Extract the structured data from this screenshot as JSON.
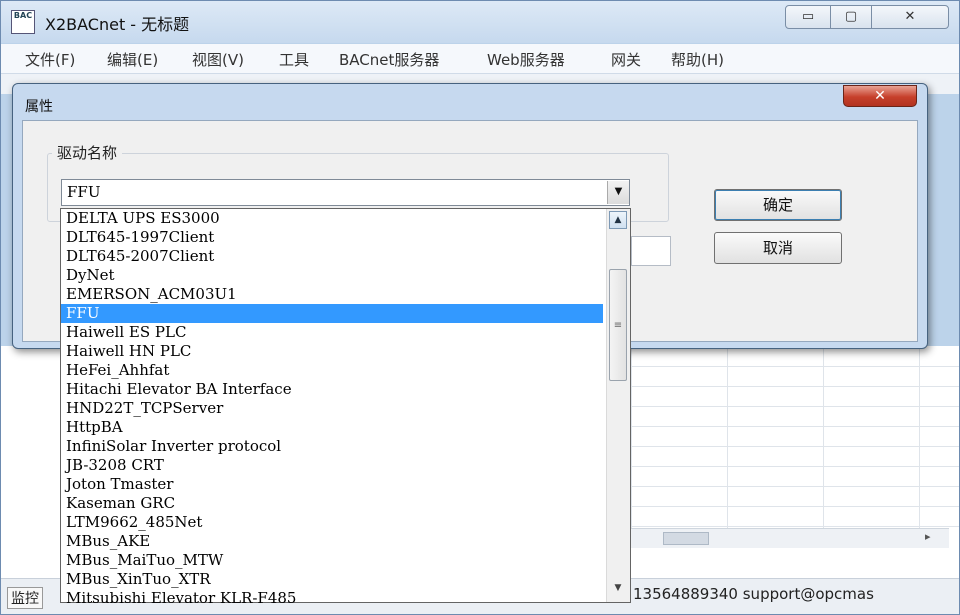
{
  "window": {
    "title": "X2BACnet - 无标题",
    "icon_text": "BAC",
    "buttons": {
      "minimize": "▭",
      "maximize": "▢",
      "close": "✕"
    }
  },
  "menubar": {
    "items": [
      "文件(F)",
      "编辑(E)",
      "视图(V)",
      "工具",
      "BACnet服务器",
      "Web服务器",
      "网关",
      "帮助(H)"
    ]
  },
  "statusbar": {
    "left_text": "监控",
    "contact": "13564889340 support@opcmas"
  },
  "dialog": {
    "title": "属性",
    "close_label": "✕",
    "group_label": "驱动名称",
    "combo_value": "FFU",
    "ok_label": "确定",
    "cancel_label": "取消"
  },
  "dropdown": {
    "selected": "FFU",
    "items": [
      "DELTA UPS ES3000",
      "DLT645-1997Client",
      "DLT645-2007Client",
      "DyNet",
      "EMERSON_ACM03U1",
      "FFU",
      "Haiwell ES PLC",
      "Haiwell HN PLC",
      "HeFei_Ahhfat",
      "Hitachi Elevator BA Interface",
      "HND22T_TCPServer",
      "HttpBA",
      "InfiniSolar Inverter protocol",
      "JB-3208 CRT",
      "Joton Tmaster",
      "Kaseman GRC",
      "LTM9662_485Net",
      "MBus_AKE",
      "MBus_MaiTuo_MTW",
      "MBus_XinTuo_XTR",
      "Mitsubishi Elevator KLR-F485"
    ]
  },
  "icons": {
    "combo_arrow": "chevron-down-icon",
    "scroll_up": "scroll-up-arrow-icon",
    "scroll_down": "scroll-down-arrow-icon",
    "app": "x2bacnet-app-icon"
  }
}
